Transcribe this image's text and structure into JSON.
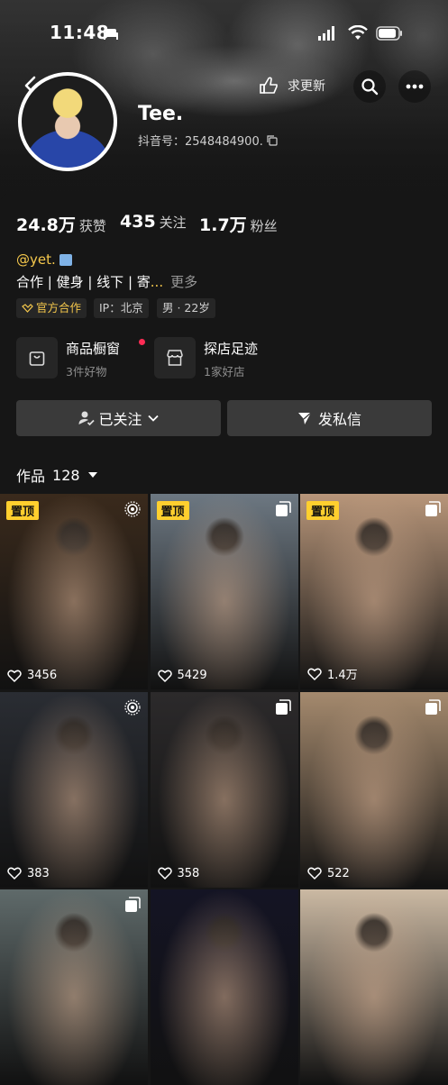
{
  "status_bar": {
    "time": "11:48"
  },
  "header": {
    "request_update_label": "求更新"
  },
  "profile": {
    "name": "Tee.",
    "douyin_id": "抖音号：2548484900."
  },
  "stats": [
    {
      "value": "24.8万",
      "label": "获赞"
    },
    {
      "value": "435",
      "label": "关注"
    },
    {
      "value": "1.7万",
      "label": "粉丝"
    }
  ],
  "bio": {
    "mention": "@yet.",
    "text": "合作 | 健身 | 线下 | 寄",
    "ellipsis": "...",
    "more_label": "更多"
  },
  "tags": [
    {
      "label": "官方合作"
    },
    {
      "label": "IP：北京"
    },
    {
      "label": "男 · 22岁"
    }
  ],
  "cards": [
    {
      "title": "商品橱窗",
      "subtitle": "3件好物"
    },
    {
      "title": "探店足迹",
      "subtitle": "1家好店"
    }
  ],
  "actions": {
    "following_label": "已关注",
    "message_label": "发私信"
  },
  "works": {
    "label": "作品",
    "count": "128"
  },
  "pinned_label": "置顶",
  "grid": [
    {
      "likes": "3456",
      "pinned": true,
      "icon": "live-photo-icon",
      "tone": "#3a2a1c"
    },
    {
      "likes": "5429",
      "pinned": true,
      "icon": "gallery-icon",
      "tone": "#6d7882"
    },
    {
      "likes": "1.4万",
      "pinned": true,
      "icon": "gallery-icon",
      "tone": "#b8967a"
    },
    {
      "likes": "383",
      "pinned": false,
      "icon": "live-photo-icon",
      "tone": "#2a2d33"
    },
    {
      "likes": "358",
      "pinned": false,
      "icon": "gallery-icon",
      "tone": "#2c2a2b"
    },
    {
      "likes": "522",
      "pinned": false,
      "icon": "gallery-icon",
      "tone": "#a58a6e"
    },
    {
      "likes": "",
      "pinned": false,
      "icon": "gallery-icon",
      "tone": "#5f6a6a"
    },
    {
      "likes": "",
      "pinned": false,
      "icon": "",
      "tone": "#141424"
    },
    {
      "likes": "",
      "pinned": false,
      "icon": "",
      "tone": "#cbb9a3"
    }
  ]
}
